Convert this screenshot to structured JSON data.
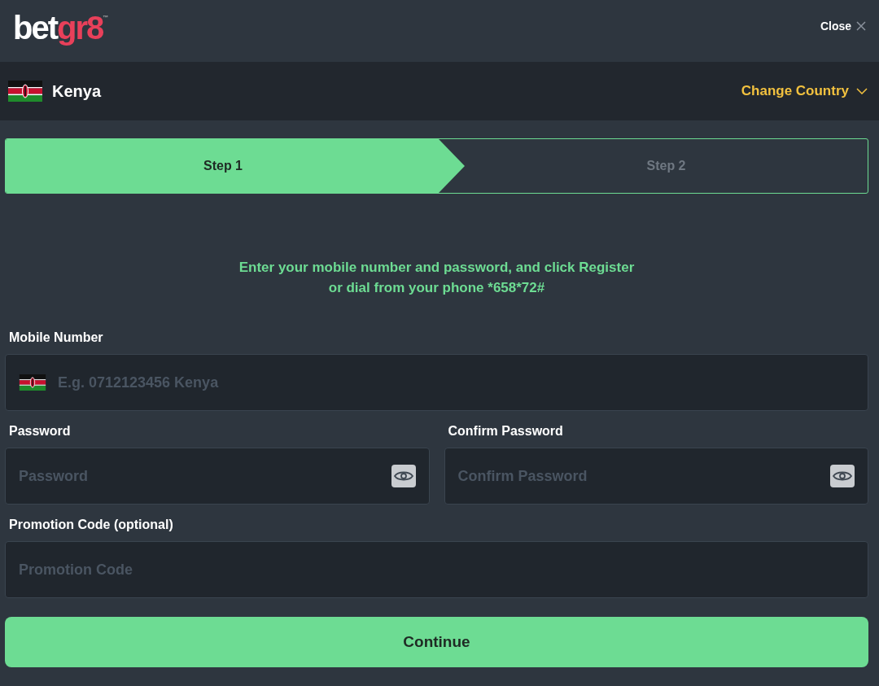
{
  "header": {
    "logo": {
      "part_1": "bet",
      "part_2": "gr8",
      "trademark": "™"
    },
    "close": "Close"
  },
  "country": {
    "name": "Kenya",
    "change": "Change Country"
  },
  "steps": [
    {
      "label": "Step 1",
      "selected": true
    },
    {
      "label": "Step 2",
      "selected": false
    }
  ],
  "instructions": [
    "Enter your mobile number and password, and click Register",
    "or dial from your phone *658*72#"
  ],
  "fields": [
    {
      "label": "Mobile Number",
      "placeholder": "E.g. 0712123456 Kenya",
      "kind": "phone"
    },
    {
      "label": "Password",
      "placeholder": "Password",
      "kind": "password"
    },
    {
      "label": "Confirm Password",
      "placeholder": "Confirm Password",
      "kind": "password"
    },
    {
      "label": "Promotion Code (optional)",
      "placeholder": "Promotion Code",
      "kind": "text"
    }
  ],
  "continue_button": "Continue"
}
